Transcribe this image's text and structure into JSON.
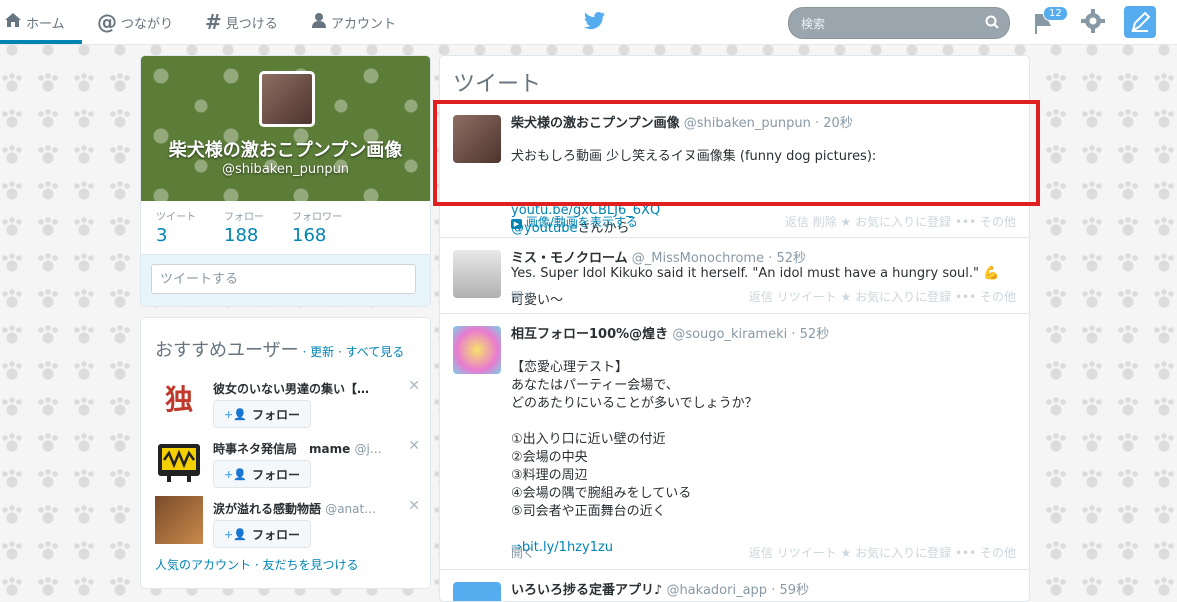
{
  "nav": {
    "home": "ホーム",
    "connect": "つながり",
    "discover": "見つける",
    "account": "アカウント",
    "search_placeholder": "検索",
    "notif_count": "12"
  },
  "profile": {
    "name": "柴犬様の激おこプンプン画像",
    "handle": "@shibaken_punpun",
    "stats": [
      {
        "label": "ツイート",
        "value": "3"
      },
      {
        "label": "フォロー",
        "value": "188"
      },
      {
        "label": "フォロワー",
        "value": "168"
      }
    ],
    "compose_placeholder": "ツイートする"
  },
  "who_to_follow": {
    "title": "おすすめユーザー",
    "links": "· 更新 · すべて見る",
    "users": [
      {
        "name": "彼女のいない男達の集い【…",
        "handle": ""
      },
      {
        "name": "時事ネタ発信局　mame",
        "handle": "@j…"
      },
      {
        "name": "涙が溢れる感動物語",
        "handle": "@anat…"
      }
    ],
    "follow_label": "フォロー",
    "footer": "人気のアカウント · 友だちを見つける"
  },
  "timeline": {
    "title": "ツイート",
    "tweets": [
      {
        "name": "柴犬様の激おこプンプン画像",
        "handle": "@shibaken_punpun",
        "time": "· 20秒",
        "line1": "犬おもしろ動画 少し笑えるイヌ画像集 (funny dog pictures):",
        "link1": "youtu.be/gxCBLJ6_6XQ",
        "link2": "@youtube",
        "suffix": "さんから",
        "line3": "可愛い～",
        "media": "画像/動画を表示する",
        "actions": "返信   削除   ★ お気に入りに登録   ••• その他"
      },
      {
        "name": "ミス・モノクローム",
        "handle": "@_MissMonochrome",
        "time": "· 52秒",
        "text": "Yes. Super Idol Kikuko said it herself. \"An idol must have a hungry soul.\" 💪",
        "open": "開く",
        "actions": "返信   リツイート   ★ お気に入りに登録   ••• その他"
      },
      {
        "name": "相互フォロー100%@煌き",
        "handle": "@sougo_kirameki",
        "time": "· 52秒",
        "text": "【恋愛心理テスト】\nあなたはパーティー会場で、\nどのあたりにいることが多いでしょうか？\n\n①出入り口に近い壁の付近\n②会場の中央\n③料理の周辺\n④会場の隅で腕組みをしている\n⑤司会者や正面舞台の近く\n",
        "link": "⇒bit.ly/1hzy1zu",
        "open": "開く",
        "actions": "返信   リツイート   ★ お気に入りに登録   ••• その他"
      },
      {
        "name": "いろいろ捗る定番アプリ♪",
        "handle": "@hakadori_app",
        "time": "· 59秒"
      }
    ]
  },
  "colors": {
    "accent": "#55acee",
    "link": "#0084b4",
    "highlight": "#e02020"
  }
}
